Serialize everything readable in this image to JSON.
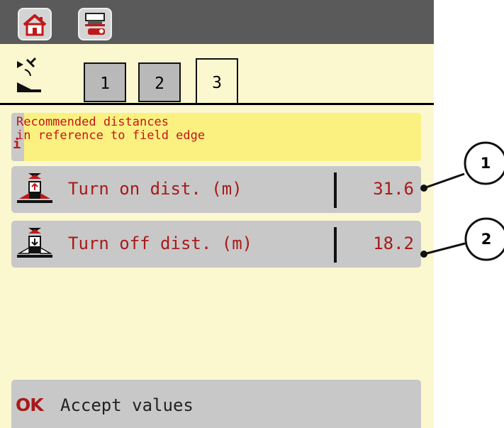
{
  "topbar": {
    "home_icon": "home-icon",
    "settings_icon": "spreader-settings-icon"
  },
  "tabs": [
    {
      "label": "1",
      "active": false
    },
    {
      "label": "2",
      "active": false
    },
    {
      "label": "3",
      "active": true
    }
  ],
  "gps_icon": "gps-spreading-icon",
  "info": {
    "icon": "i",
    "line1": "Recommended distances",
    "line2": "in reference to field edge"
  },
  "rows": {
    "turn_on": {
      "label": "Turn on dist. (m)",
      "value": "31.6",
      "icon": "spreader-turn-on-icon"
    },
    "turn_off": {
      "label": "Turn off dist. (m)",
      "value": "18.2",
      "icon": "spreader-turn-off-icon"
    }
  },
  "accept": {
    "icon": "OK",
    "label": "Accept values"
  },
  "callouts": {
    "one": "1",
    "two": "2"
  },
  "colors": {
    "background": "#fbf8d0",
    "topbar": "#5a5a5a",
    "info_bg": "#fbf181",
    "row_bg": "#c8c8c8",
    "text_red": "#a81a1a"
  }
}
